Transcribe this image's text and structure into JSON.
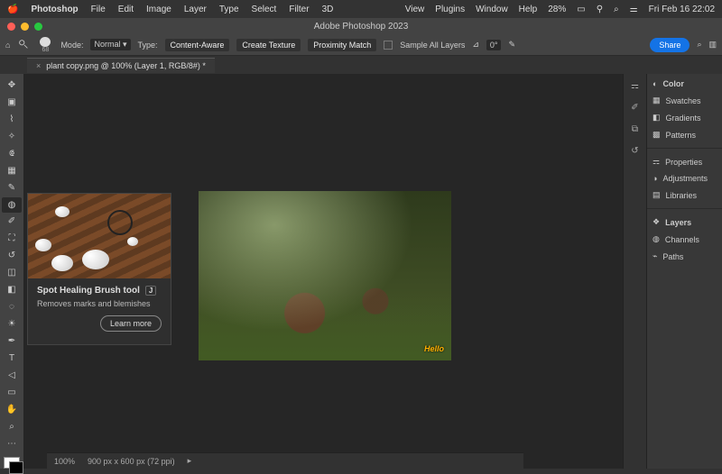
{
  "mac_menu": {
    "app": "Photoshop",
    "items": [
      "File",
      "Edit",
      "Image",
      "Layer",
      "Type",
      "Select",
      "Filter",
      "3D",
      "View",
      "Plugins",
      "Window",
      "Help"
    ],
    "battery": "28%",
    "datetime": "Fri Feb 16  22:02"
  },
  "window_title": "Adobe Photoshop 2023",
  "traffic_colors": [
    "#ff5f57",
    "#febc2e",
    "#28c840"
  ],
  "options_bar": {
    "brush_size": "68",
    "mode_label": "Mode:",
    "mode_value": "Normal",
    "type_label": "Type:",
    "chips": [
      "Content-Aware",
      "Create Texture",
      "Proximity Match"
    ],
    "sample_all": "Sample All Layers",
    "angle_label": "⊿",
    "angle_value": "0°",
    "share": "Share"
  },
  "tab": {
    "name": "plant copy.png @ 100% (Layer 1, RGB/8#) *"
  },
  "tooltip": {
    "title": "Spot Healing Brush tool",
    "key": "J",
    "desc": "Removes marks and blemishes",
    "learn": "Learn more"
  },
  "canvas_tag": "Hello",
  "panels": {
    "group1": [
      "Color",
      "Swatches",
      "Gradients",
      "Patterns"
    ],
    "group2": [
      "Properties",
      "Adjustments",
      "Libraries"
    ],
    "group3": [
      "Layers",
      "Channels",
      "Paths"
    ]
  },
  "status": {
    "zoom": "100%",
    "dims": "900 px x 600 px (72 ppi)"
  },
  "tool_icons": [
    "move",
    "marquee",
    "lasso",
    "wand",
    "crop",
    "frame",
    "eyedrop",
    "heal",
    "brush",
    "stamp",
    "history",
    "eraser",
    "gradient",
    "blur",
    "dodge",
    "pen",
    "type",
    "path",
    "rect",
    "hand",
    "zoom"
  ],
  "ribbon_icons": [
    "props",
    "brush-panel",
    "clone",
    "history-p",
    "char",
    "align"
  ]
}
